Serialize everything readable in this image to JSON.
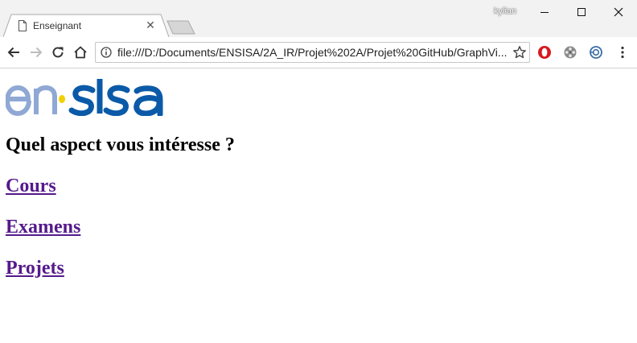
{
  "browser": {
    "tab_title": "Enseignant",
    "profile_name": "kylian",
    "url": "file:///D:/Documents/ENSISA/2A_IR/Projet%202A/Projet%20GitHub/GraphVi..."
  },
  "page": {
    "logo_text": "ensisa",
    "heading": "Quel aspect vous intéresse ?",
    "links": [
      {
        "label": "Cours"
      },
      {
        "label": "Examens"
      },
      {
        "label": "Projets"
      }
    ]
  },
  "colors": {
    "visited_link": "#551a8b",
    "logo_light_blue": "#8fa8d4",
    "logo_dark_blue": "#0a5aa8",
    "logo_dot": "#f2d000"
  }
}
